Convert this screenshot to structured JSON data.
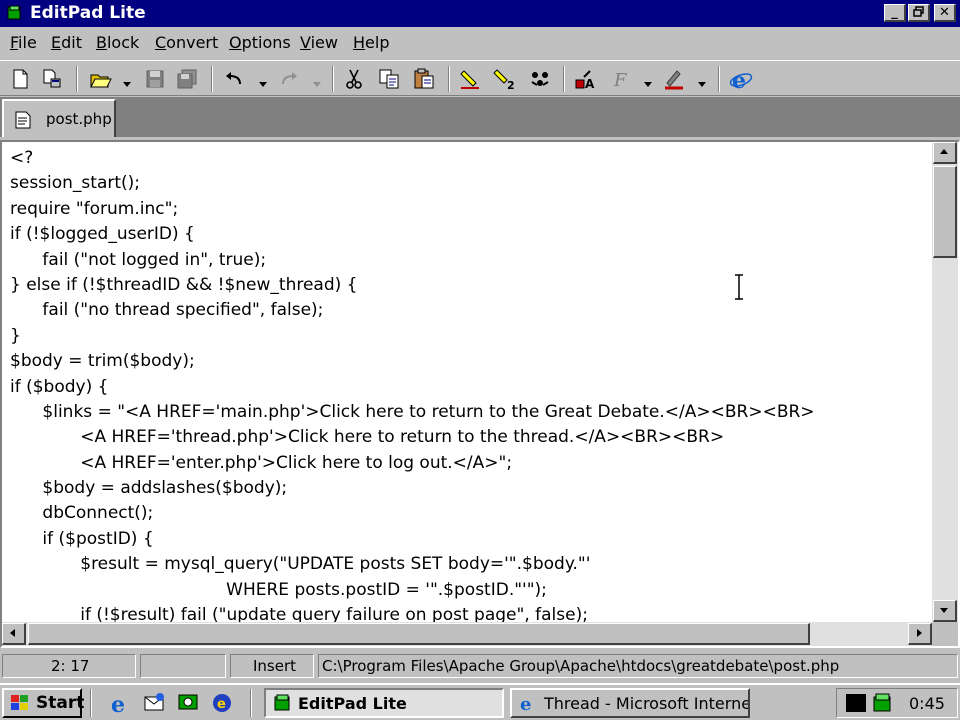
{
  "window": {
    "title": "EditPad Lite"
  },
  "menu": [
    "File",
    "Edit",
    "Block",
    "Convert",
    "Options",
    "View",
    "Help"
  ],
  "toolbar_icons": [
    "new-file-icon",
    "new-window-icon",
    "open-icon",
    "save-icon",
    "save-all-icon",
    "undo-icon",
    "redo-icon",
    "cut-icon",
    "copy-icon",
    "paste-icon",
    "mark-icon",
    "mark-two-icon",
    "clear-marks-icon",
    "find-replace-icon",
    "font-icon",
    "highlight-icon",
    "browser-icon"
  ],
  "tabs": [
    {
      "label": "post.php"
    }
  ],
  "editor": {
    "lines": [
      "<?",
      "session_start();",
      "require \"forum.inc\";",
      "if (!$logged_userID) {",
      "      fail (\"not logged in\", true);",
      "} else if (!$threadID && !$new_thread) {",
      "      fail (\"no thread specified\", false);",
      "}",
      "$body = trim($body);",
      "if ($body) {",
      "      $links = \"<A HREF='main.php'>Click here to return to the Great Debate.</A><BR><BR>",
      "             <A HREF='thread.php'>Click here to return to the thread.</A><BR><BR>",
      "             <A HREF='enter.php'>Click here to log out.</A>\";",
      "      $body = addslashes($body);",
      "      dbConnect();",
      "      if ($postID) {",
      "             $result = mysql_query(\"UPDATE posts SET body='\".$body.\"'",
      "                                        WHERE posts.postID = '\".$postID.\"'\");",
      "             if (!$result) fail (\"update query failure on post page\", false);"
    ]
  },
  "statusbar": {
    "position": "2: 17",
    "mode": "Insert",
    "path": "C:\\Program Files\\Apache Group\\Apache\\htdocs\\greatdebate\\post.php"
  },
  "taskbar": {
    "start_label": "Start",
    "tasks": [
      {
        "label": "EditPad Lite",
        "active": true
      },
      {
        "label": "Thread - Microsoft Internet...",
        "active": false
      }
    ],
    "clock": "0:45"
  },
  "colors": {
    "titlebar": "#000080",
    "face": "#c0c0c0",
    "editor_bg": "#ffffff"
  }
}
